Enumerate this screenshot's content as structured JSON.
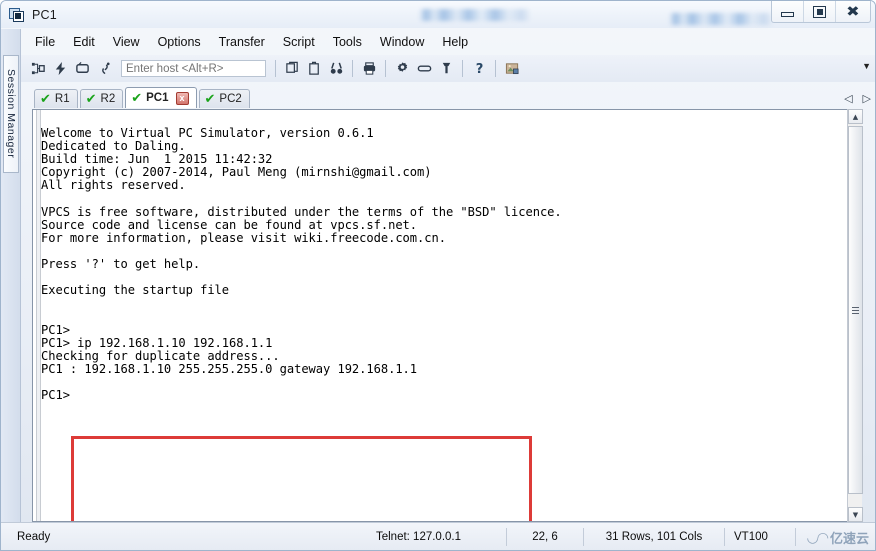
{
  "window": {
    "title": "PC1",
    "icon": "terminal-window-icon",
    "buttons": {
      "minimize": "minimize-icon",
      "maximize": "maximize-icon",
      "close": "close-icon"
    }
  },
  "menubar": {
    "items": [
      {
        "id": "file",
        "label": "File"
      },
      {
        "id": "edit",
        "label": "Edit"
      },
      {
        "id": "view",
        "label": "View"
      },
      {
        "id": "options",
        "label": "Options"
      },
      {
        "id": "transfer",
        "label": "Transfer"
      },
      {
        "id": "script",
        "label": "Script"
      },
      {
        "id": "tools",
        "label": "Tools"
      },
      {
        "id": "window",
        "label": "Window"
      },
      {
        "id": "help",
        "label": "Help"
      }
    ]
  },
  "toolbar": {
    "host_input": {
      "value": "",
      "placeholder": "Enter host <Alt+R>"
    },
    "overflow_label": "▼",
    "icons": [
      "new-session-icon",
      "quick-connect-icon",
      "reconnect-icon",
      "disconnect-icon",
      "copy-icon",
      "paste-icon",
      "find-icon",
      "print-icon",
      "settings-icon",
      "keymap-icon",
      "key-icon",
      "help-icon",
      "image-icon"
    ]
  },
  "sidebar": {
    "session_manager_label": "Session Manager"
  },
  "tabbar": {
    "tabs": [
      {
        "id": "r1",
        "label": "R1",
        "active": false,
        "status": "connected"
      },
      {
        "id": "r2",
        "label": "R2",
        "active": false,
        "status": "connected"
      },
      {
        "id": "pc1",
        "label": "PC1",
        "active": true,
        "status": "connected",
        "close_label": "x"
      },
      {
        "id": "pc2",
        "label": "PC2",
        "active": false,
        "status": "connected"
      }
    ],
    "nav_prev": "◁",
    "nav_next": "▷"
  },
  "terminal": {
    "content": "Welcome to Virtual PC Simulator, version 0.6.1\nDedicated to Daling.\nBuild time: Jun  1 2015 11:42:32\nCopyright (c) 2007-2014, Paul Meng (mirnshi@gmail.com)\nAll rights reserved.\n\nVPCS is free software, distributed under the terms of the \"BSD\" licence.\nSource code and license can be found at vpcs.sf.net.\nFor more information, please visit wiki.freecode.com.cn.\n\nPress '?' to get help.\n\nExecuting the startup file\n\n\nPC1>\nPC1> ip 192.168.1.10 192.168.1.1\nChecking for duplicate address...\nPC1 : 192.168.1.10 255.255.255.0 gateway 192.168.1.1\n\nPC1>",
    "annotation_color": "#dd3b38"
  },
  "scrollbar": {
    "up_label": "▲",
    "down_label": "▼"
  },
  "statusbar": {
    "state": "Ready",
    "connection": "Telnet: 127.0.0.1",
    "cursor_position": "22,  6",
    "dimensions": "31 Rows, 101 Cols",
    "emulation": "VT100",
    "watermark": "亿速云"
  }
}
